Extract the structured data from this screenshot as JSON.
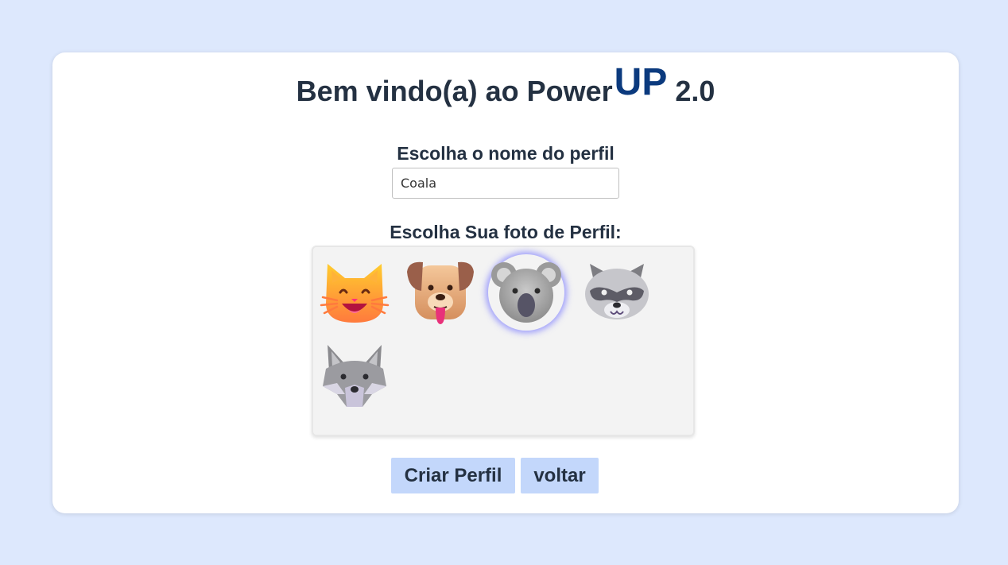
{
  "header": {
    "title_prefix": "Bem vindo(a) ao Power",
    "title_brand": "UP",
    "title_suffix": " 2.0"
  },
  "form": {
    "name_label": "Escolha o nome do perfil",
    "name_value": "Coala",
    "photo_label": "Escolha Sua foto de Perfil:"
  },
  "avatars": [
    {
      "name": "cat",
      "icon": "cat-face-icon",
      "selected": false
    },
    {
      "name": "dog",
      "icon": "dog-face-icon",
      "selected": false
    },
    {
      "name": "koala",
      "icon": "koala-face-icon",
      "selected": true
    },
    {
      "name": "raccoon",
      "icon": "raccoon-face-icon",
      "selected": false
    },
    {
      "name": "wolf",
      "icon": "wolf-face-icon",
      "selected": false
    }
  ],
  "buttons": {
    "create_label": "Criar Perfil",
    "back_label": "voltar"
  },
  "colors": {
    "page_background": "#dde8fd",
    "brand": "#0b3a7e",
    "button_background": "#c3d7fb",
    "selection_glow": "#7878ff"
  }
}
